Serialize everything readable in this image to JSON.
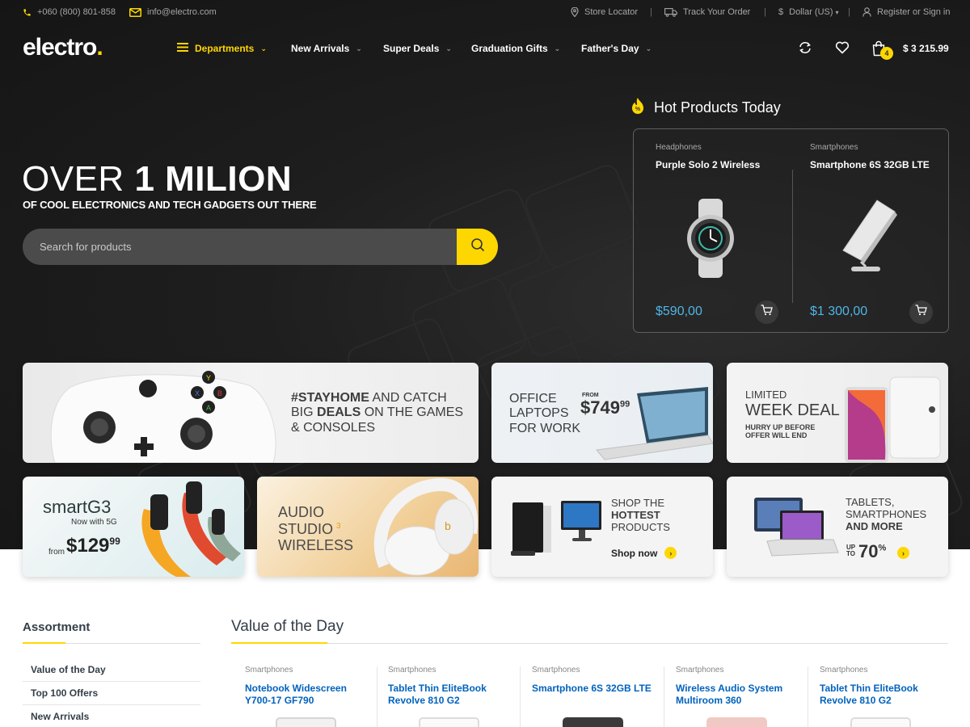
{
  "topbar": {
    "phone": "+060 (800) 801-858",
    "email": "info@electro.com",
    "store_locator": "Store Locator",
    "track_order": "Track Your Order",
    "currency": "Dollar (US)",
    "account": "Register or Sign in"
  },
  "header": {
    "logo_text": "electro",
    "logo_dot": ".",
    "nav": {
      "departments": "Departments",
      "new_arrivals": "New Arrivals",
      "super_deals": "Super Deals",
      "graduation_gifts": "Graduation Gifts",
      "fathers_day": "Father's Day"
    },
    "cart_count": "4",
    "cart_total": "$ 3 215.99"
  },
  "hero": {
    "title_light": "OVER",
    "title_bold": "1 MILION",
    "subtitle": "OF COOL ELECTRONICS AND TECH GADGETS OUT THERE",
    "search_placeholder": "Search for products"
  },
  "hot_products": {
    "title": "Hot Products Today",
    "items": [
      {
        "category": "Headphones",
        "name": "Purple Solo 2 Wireless",
        "price": "$590,00"
      },
      {
        "category": "Smartphones",
        "name": "Smartphone 6S 32GB LTE",
        "price": "$1 300,00"
      }
    ]
  },
  "banners": {
    "xbox": {
      "line1_a": "#STAYHOME",
      "line1_b": "AND CATCH",
      "line2_a": "BIG",
      "line2_b": "DEALS",
      "line2_c": "ON THE GAMES",
      "line3": "& CONSOLES"
    },
    "laptop": {
      "line1": "OFFICE",
      "line2": "LAPTOPS",
      "line3": "FOR WORK",
      "from": "FROM",
      "price_main": "$749",
      "price_cents": "99"
    },
    "week": {
      "line1": "LIMITED",
      "line2": "WEEK DEAL",
      "line3": "HURRY UP BEFORE",
      "line4": "OFFER WILL END"
    },
    "smart": {
      "name": "smartG3",
      "sub": "Now with 5G",
      "from": "from",
      "price_main": "$129",
      "price_cents": "99"
    },
    "audio": {
      "line1": "AUDIO",
      "line2": "STUDIO",
      "sup": "3",
      "line3": "WIRELESS"
    },
    "hot": {
      "line1": "SHOP THE",
      "line2": "HOTTEST",
      "line3": "PRODUCTS",
      "cta": "Shop now"
    },
    "tablets": {
      "line1": "TABLETS,",
      "line2": "SMARTPHONES",
      "line3": "AND MORE",
      "up": "UP",
      "to": "TO",
      "discount": "70",
      "pct": "%"
    }
  },
  "assortment": {
    "title": "Assortment",
    "items": [
      "Value of the Day",
      "Top 100 Offers",
      "New Arrivals"
    ]
  },
  "value_of_day": {
    "title": "Value of the Day",
    "products": [
      {
        "category": "Smartphones",
        "name": "Notebook Widescreen Y700-17 GF790"
      },
      {
        "category": "Smartphones",
        "name": "Tablet Thin EliteBook Revolve 810 G2"
      },
      {
        "category": "Smartphones",
        "name": "Smartphone 6S 32GB LTE"
      },
      {
        "category": "Smartphones",
        "name": "Wireless Audio System Multiroom 360"
      },
      {
        "category": "Smartphones",
        "name": "Tablet Thin EliteBook Revolve 810 G2"
      }
    ]
  },
  "colors": {
    "accent": "#fed700",
    "link": "#0062bd",
    "price": "#4fb6e6",
    "dark_bg": "#1e1e1e"
  },
  "icons": [
    "phone-icon",
    "mail-icon",
    "map-pin-icon",
    "truck-icon",
    "dollar-icon",
    "user-icon",
    "menu-icon",
    "compare-icon",
    "heart-icon",
    "cart-icon",
    "search-icon",
    "fire-icon",
    "add-to-cart-icon",
    "arrow-right-icon"
  ]
}
